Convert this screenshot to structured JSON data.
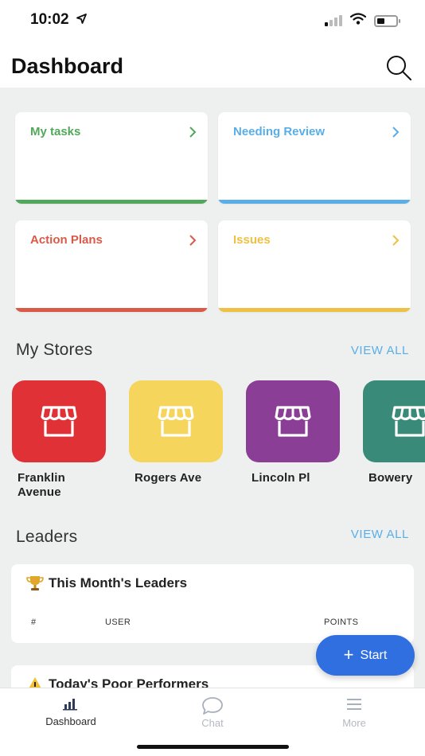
{
  "status_bar": {
    "time": "10:02",
    "battery_level": 0.35
  },
  "header": {
    "title": "Dashboard",
    "search_icon": "search-icon"
  },
  "cards": [
    {
      "title": "My tasks",
      "color": "#52a85a"
    },
    {
      "title": "Needing Review",
      "color": "#5aaee8"
    },
    {
      "title": "Action Plans",
      "color": "#d95a48"
    },
    {
      "title": "Issues",
      "color": "#eec043"
    }
  ],
  "stores_section": {
    "title": "My Stores",
    "view_all": "VIEW ALL",
    "items": [
      {
        "name": "Franklin Avenue",
        "color": "#e03236",
        "icon": "storefront-icon"
      },
      {
        "name": "Rogers Ave",
        "color": "#f5d55c",
        "icon": "storefront-icon"
      },
      {
        "name": "Lincoln Pl",
        "color": "#8b3e96",
        "icon": "storefront-icon"
      },
      {
        "name": "Bowery",
        "color": "#3a8a7a",
        "icon": "storefront-icon"
      }
    ]
  },
  "leaders_section": {
    "title": "Leaders",
    "view_all": "VIEW ALL",
    "month_heading": "This Month's Leaders",
    "columns": [
      "#",
      "USER",
      "POINTS"
    ],
    "poor_heading": "Today's Poor Performers"
  },
  "fab": {
    "label": "Start",
    "color": "#2f6fe0"
  },
  "tabs": [
    {
      "label": "Dashboard",
      "icon": "bar-chart-icon",
      "active": true
    },
    {
      "label": "Chat",
      "icon": "chat-bubble-icon",
      "active": false
    },
    {
      "label": "More",
      "icon": "menu-icon",
      "active": false
    }
  ],
  "colors": {
    "view_all": "#5aaee8",
    "background": "#eef0f0"
  }
}
